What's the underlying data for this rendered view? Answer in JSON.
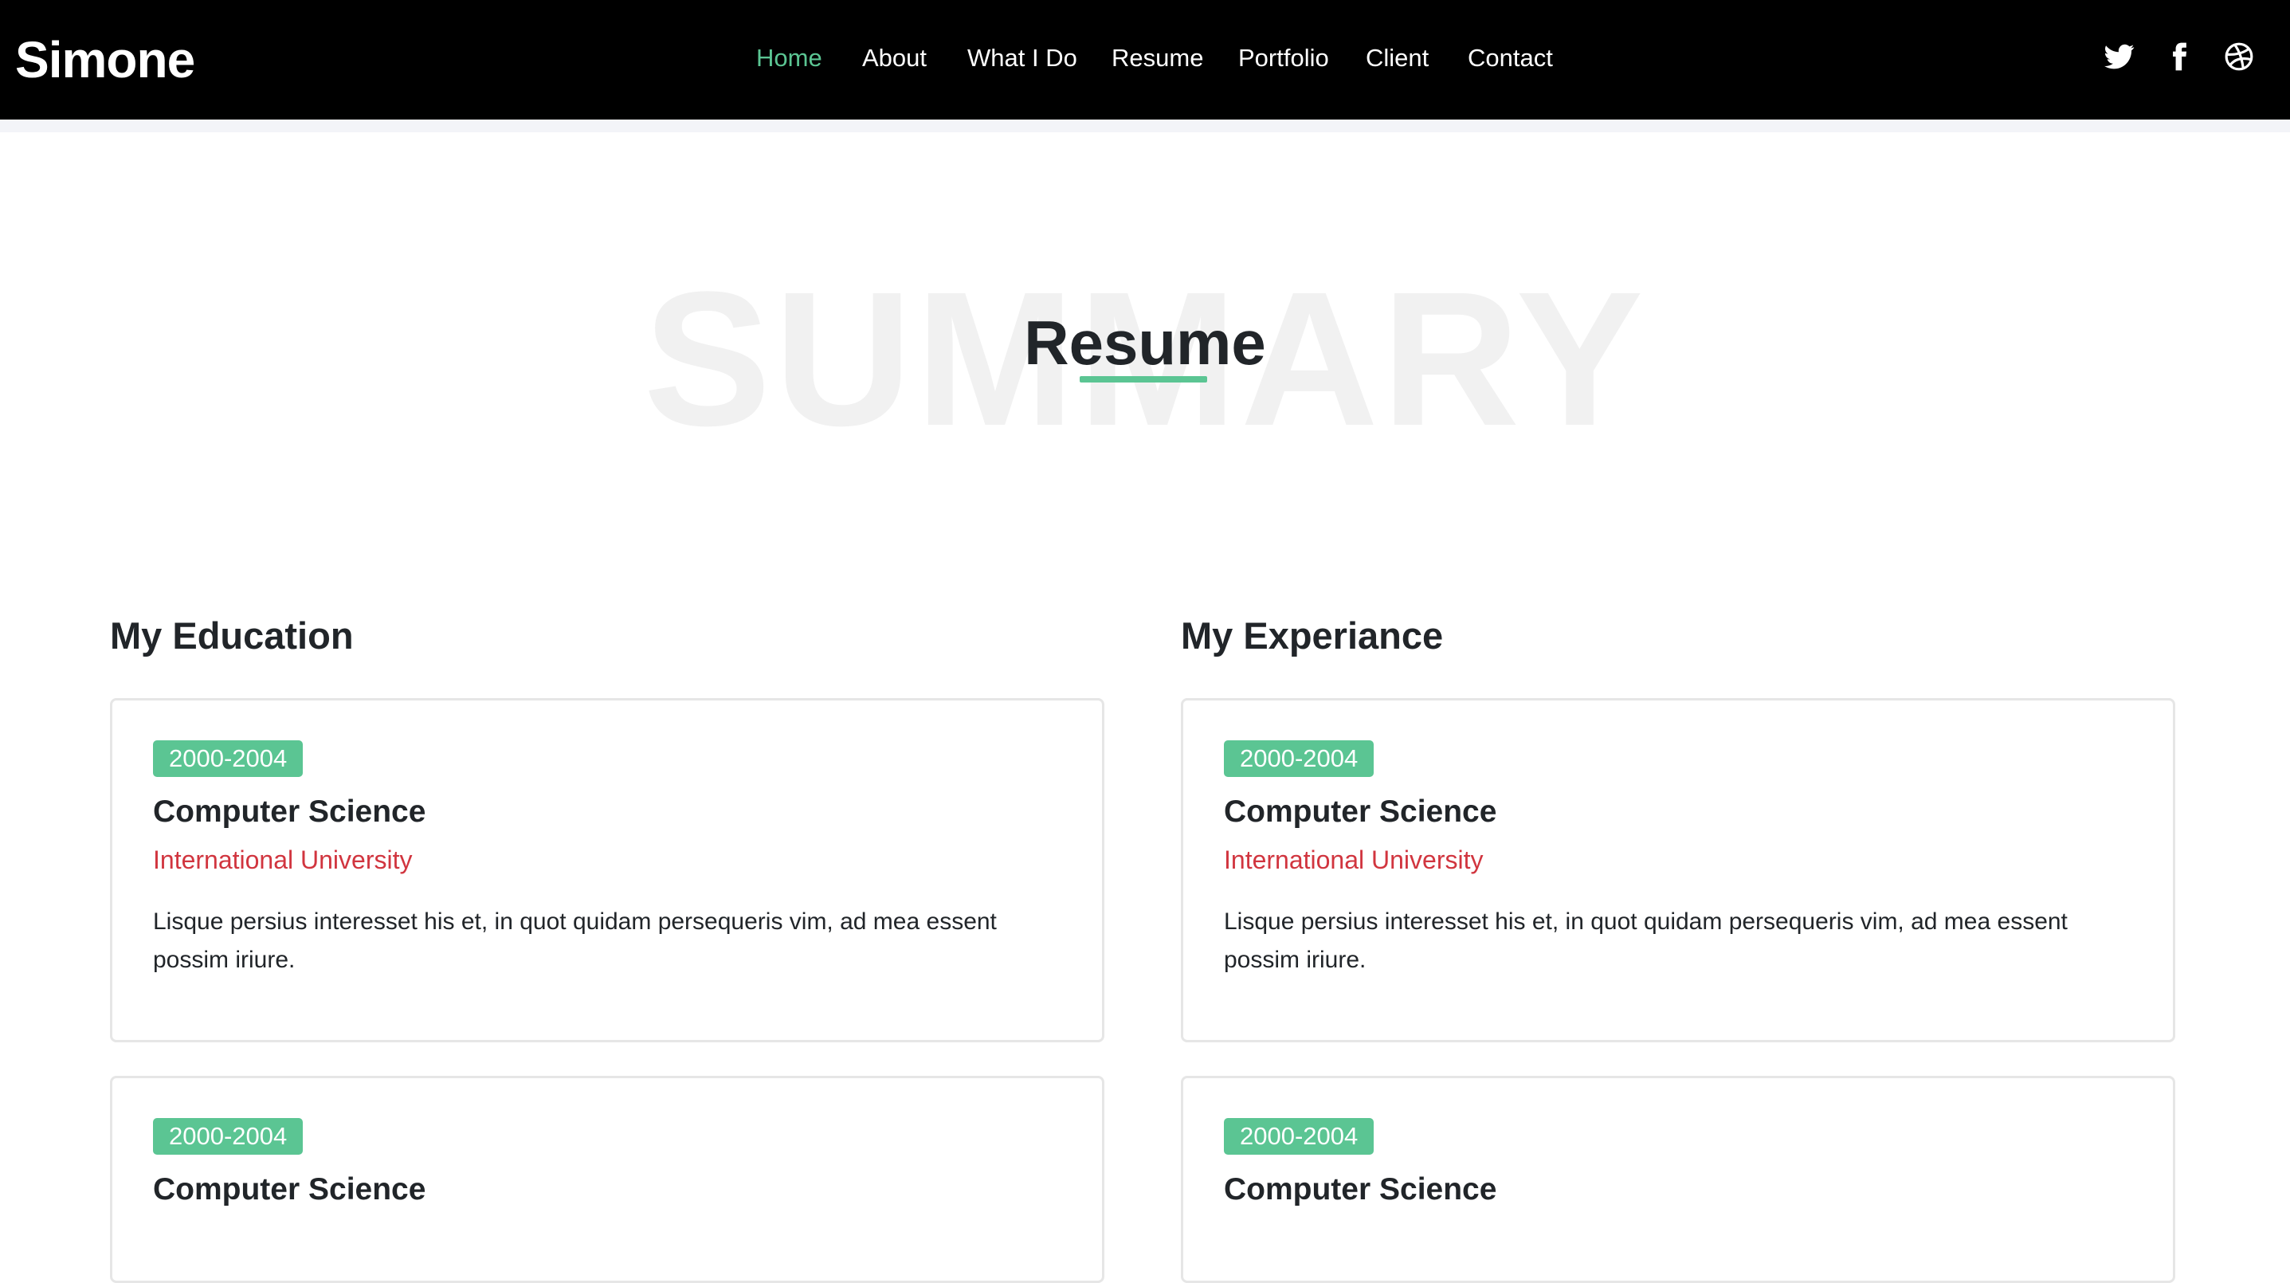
{
  "header": {
    "brand": "Simone",
    "nav": [
      "Home",
      "About",
      "What I Do",
      "Resume",
      "Portfolio",
      "Client",
      "Contact"
    ],
    "active_index": 0,
    "social_icons": [
      "twitter-icon",
      "facebook-icon",
      "dribbble-icon"
    ]
  },
  "section": {
    "background_word": "SUMMARY",
    "title": "Resume"
  },
  "education": {
    "title": "My Education",
    "items": [
      {
        "period": "2000-2004",
        "title": "Computer Science",
        "institution": "International University",
        "description": "Lisque persius interesset his et, in quot quidam persequeris vim, ad mea essent possim iriure."
      },
      {
        "period": "2000-2004",
        "title": "Computer Science"
      }
    ]
  },
  "experience": {
    "title": "My Experiance",
    "items": [
      {
        "period": "2000-2004",
        "title": "Computer Science",
        "institution": "International University",
        "description": "Lisque persius interesset his et, in quot quidam persequeris vim, ad mea essent possim iriure."
      },
      {
        "period": "2000-2004",
        "title": "Computer Science"
      }
    ]
  },
  "colors": {
    "accent": "#5bc593",
    "institution": "#d1353f",
    "navbar": "#000000"
  }
}
